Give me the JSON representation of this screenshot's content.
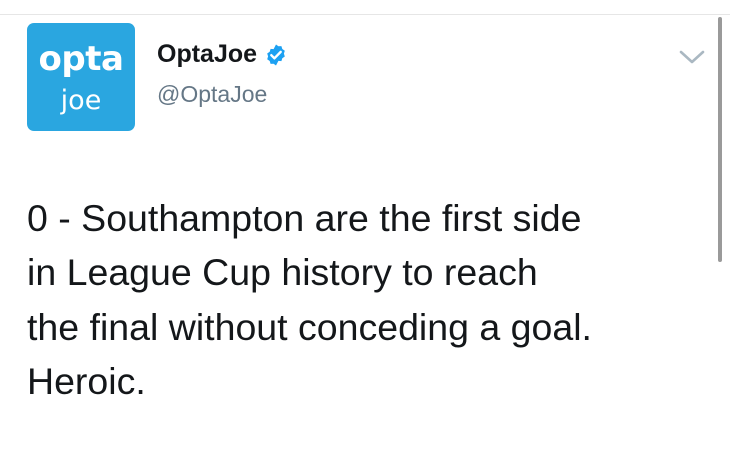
{
  "tweet": {
    "avatar": {
      "line1": "opta",
      "line2": "joe",
      "color": "#2aa6e0"
    },
    "author": {
      "display_name": "OptaJoe",
      "handle": "@OptaJoe",
      "verified": true,
      "verified_icon": "verified-badge-icon"
    },
    "menu_icon": "chevron-down-icon",
    "text": "0 - Southampton are the first side\nin League Cup history to reach\nthe final without conceding a goal.\nHeroic."
  }
}
